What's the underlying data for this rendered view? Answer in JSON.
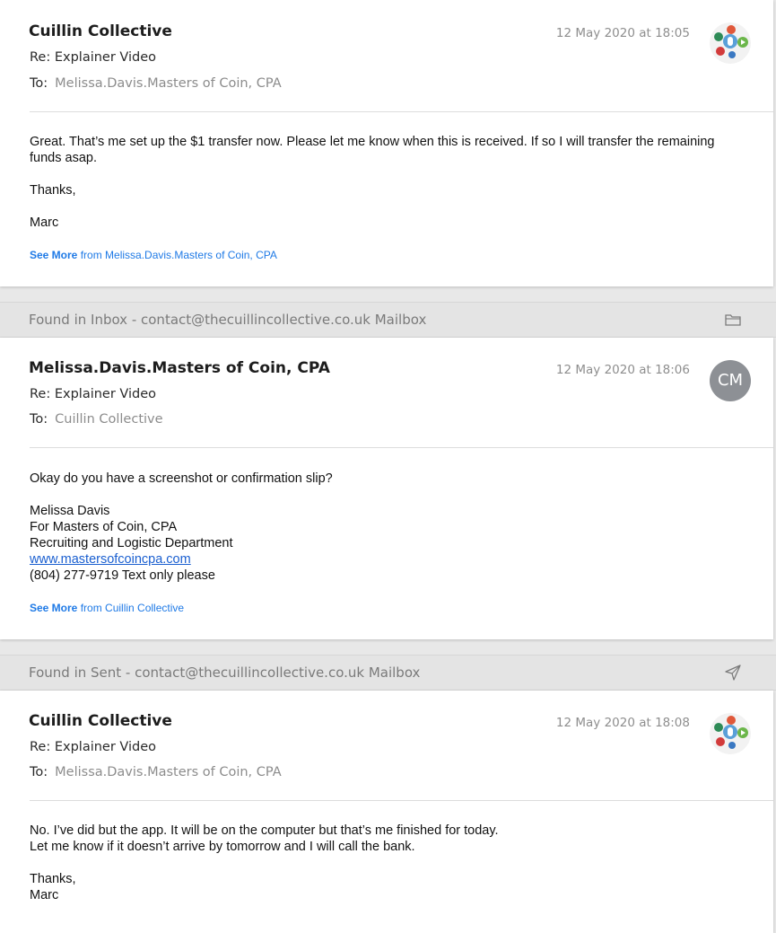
{
  "messages": [
    {
      "sender": "Cuillin Collective",
      "date": "12 May 2020 at 18:05",
      "subject": "Re: Explainer Video",
      "to_label": "To:",
      "to_name": "Melissa.Davis.Masters of Coin, CPA",
      "avatar": "cuillin-logo",
      "body": [
        "Great. That’s me set up the $1 transfer now. Please let me know when this is received. If so I will transfer the remaining funds asap.",
        "Thanks,",
        "Marc"
      ],
      "see_more_label": "See More",
      "see_more_from": "from Melissa.Davis.Masters of Coin, CPA"
    },
    {
      "found_in": "Found in Inbox - contact@thecuillincollective.co.uk Mailbox",
      "found_icon": "folder-icon",
      "sender": "Melissa.Davis.Masters of Coin, CPA",
      "date": "12 May 2020 at 18:06",
      "subject": "Re: Explainer Video",
      "to_label": "To:",
      "to_name": "Cuillin Collective",
      "avatar_initials": "CM",
      "body_first": "Okay do you have a screenshot or confirmation slip?",
      "signature": {
        "name": "Melissa Davis",
        "company": "For Masters of Coin, CPA",
        "department": "Recruiting and Logistic Department",
        "website": "www.mastersofcoincpa.com",
        "phone": "(804) 277-9719 Text only please"
      },
      "see_more_label": "See More",
      "see_more_from": "from Cuillin Collective"
    },
    {
      "found_in": "Found in Sent - contact@thecuillincollective.co.uk Mailbox",
      "found_icon": "paper-plane-icon",
      "sender": "Cuillin Collective",
      "date": "12 May 2020 at 18:08",
      "subject": "Re: Explainer Video",
      "to_label": "To:",
      "to_name": "Melissa.Davis.Masters of Coin, CPA",
      "avatar": "cuillin-logo",
      "body_line1": "No. I’ve did but the app. It will be on the computer but that’s me finished for today.",
      "body_line2": "Let me know if it doesn’t arrive by tomorrow and I will call the bank.",
      "sign_off": "Thanks,",
      "sign_name": "Marc"
    }
  ],
  "colors": {
    "link": "#1f7ae6",
    "found_bar": "#e4e4e4",
    "avatar_gray": "#8d9095"
  }
}
